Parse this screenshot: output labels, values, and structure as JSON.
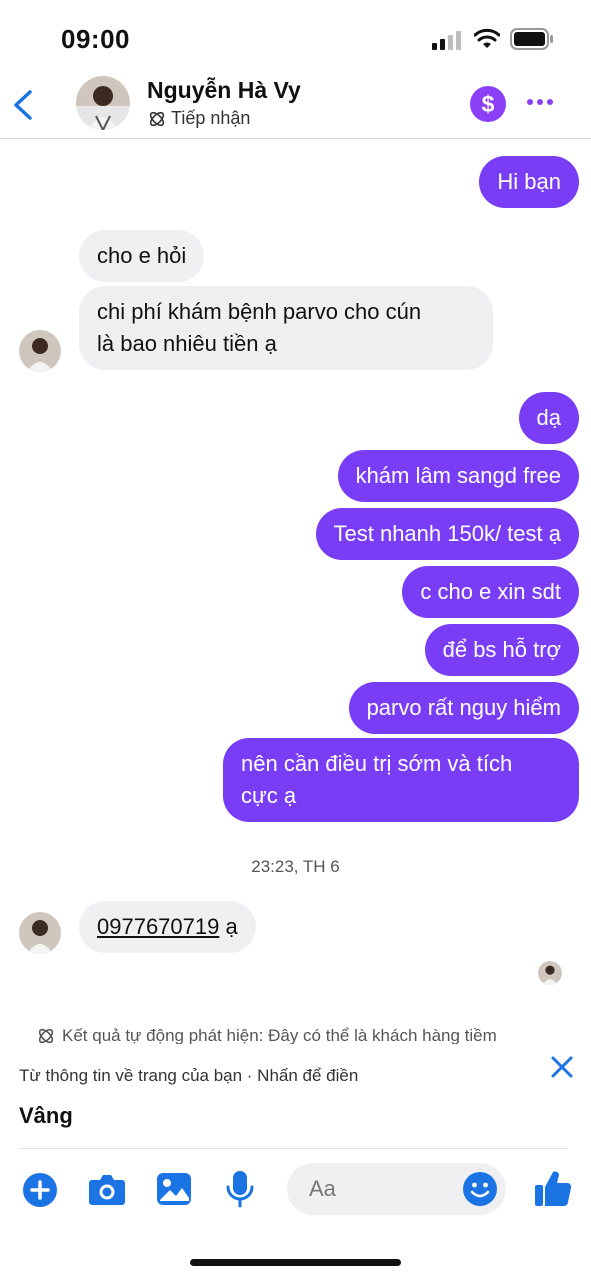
{
  "status_bar": {
    "time": "09:00"
  },
  "header": {
    "contact_name": "Nguyễn Hà Vy",
    "contact_status": "Tiếp nhận"
  },
  "messages": [
    {
      "side": "out",
      "text": "Hi bạn"
    },
    {
      "side": "in",
      "text": "cho e hỏi"
    },
    {
      "side": "in",
      "text_lines": [
        "chi phí khám bệnh parvo cho cún",
        "là bao nhiêu tiền ạ"
      ]
    },
    {
      "side": "out",
      "text": "dạ"
    },
    {
      "side": "out",
      "text": "khám lâm sangd free"
    },
    {
      "side": "out",
      "text": "Test nhanh 150k/ test ạ"
    },
    {
      "side": "out",
      "text": "c cho e xin sdt"
    },
    {
      "side": "out",
      "text": "để bs hỗ trợ"
    },
    {
      "side": "out",
      "text": "parvo rất nguy hiểm"
    },
    {
      "side": "out",
      "text_lines": [
        "nên cần điều trị sớm và tích",
        "cực ạ"
      ]
    },
    {
      "side": "in",
      "phone": "0977670719",
      "suffix": " ạ"
    }
  ],
  "timestamp": "23:23, TH 6",
  "auto_detect": "Kết quả tự động phát hiện: Đây có thể là khách hàng tiềm",
  "suggestion": {
    "source": "Từ thông tin về trang của bạn · Nhấn để điền",
    "value": "Vâng"
  },
  "composer": {
    "placeholder": "Aa"
  },
  "colors": {
    "accent": "#7a3df6",
    "blue": "#1b74e4",
    "incoming_bg": "#f0f0f2"
  },
  "icons": [
    "back-arrow-icon",
    "dollar-icon",
    "more-dots-icon",
    "ai-sparkle-icon",
    "close-icon",
    "plus-icon",
    "camera-icon",
    "gallery-icon",
    "mic-icon",
    "emoji-icon",
    "like-icon"
  ]
}
